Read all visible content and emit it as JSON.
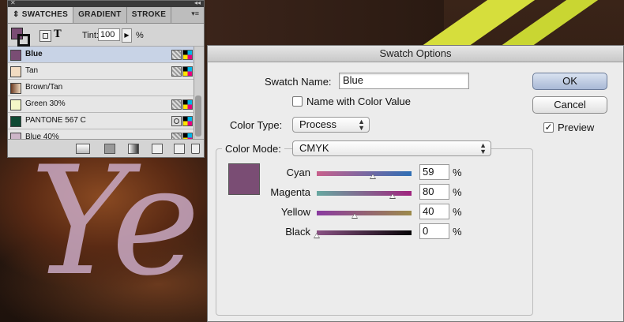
{
  "panel": {
    "tabs": [
      "SWATCHES",
      "GRADIENT",
      "STROKE"
    ],
    "tint_label": "Tint:",
    "tint_value": "100",
    "tint_unit": "%",
    "swatches": [
      {
        "name": "Blue",
        "color": "#7a4d74",
        "selected": true
      },
      {
        "name": "Tan",
        "color": "#f2dcc2",
        "selected": false
      },
      {
        "name": "Brown/Tan",
        "color": "#a46a46",
        "selected": false
      },
      {
        "name": "Green 30%",
        "color": "#f4f6c8",
        "selected": false
      },
      {
        "name": "PANTONE 567 C",
        "color": "#0f4a34",
        "selected": false
      },
      {
        "name": "Blue 40%",
        "color": "#cdb6c8",
        "selected": false
      }
    ]
  },
  "dialog": {
    "title": "Swatch Options",
    "swatch_name_label": "Swatch Name:",
    "swatch_name_value": "Blue",
    "name_with_color_value_label": "Name with Color Value",
    "color_type_label": "Color Type:",
    "color_type_value": "Process",
    "color_mode_label": "Color Mode:",
    "color_mode_value": "CMYK",
    "ok_label": "OK",
    "cancel_label": "Cancel",
    "preview_label": "Preview",
    "preview_checked": true,
    "unit": "%",
    "channels": [
      {
        "name": "Cyan",
        "value": "59",
        "gradient": "linear-gradient(90deg,#c8608c,#2f6fb5)"
      },
      {
        "name": "Magenta",
        "value": "80",
        "gradient": "linear-gradient(90deg,#66a8a0,#a0247e)"
      },
      {
        "name": "Yellow",
        "value": "40",
        "gradient": "linear-gradient(90deg,#8a3aa0,#9c8a4a)"
      },
      {
        "name": "Black",
        "value": "0",
        "gradient": "linear-gradient(90deg,#8a5284,#050305)"
      }
    ]
  },
  "artwork": {
    "script_text": "Ye"
  }
}
